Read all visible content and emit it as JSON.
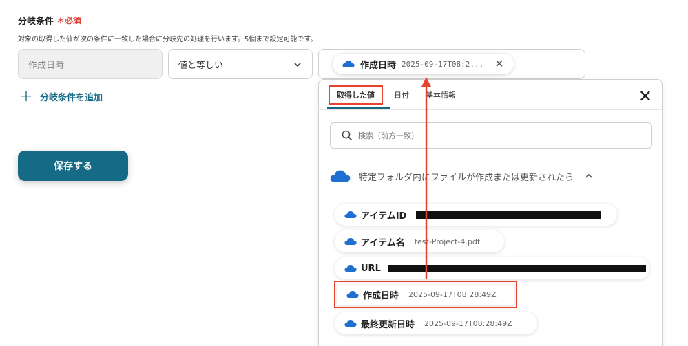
{
  "section": {
    "title": "分岐条件",
    "required_mark": "＊必須",
    "description": "対象の取得した値が次の条件に一致した場合に分岐先の処理を行います。5個まで設定可能です。"
  },
  "condition": {
    "field": "作成日時",
    "operator": "値と等しい",
    "value_chip": {
      "label": "作成日時",
      "value": "2025-09-17T08:2..."
    }
  },
  "add_condition_label": "分岐条件を追加",
  "save_label": "保存する",
  "panel": {
    "tabs": [
      {
        "label": "取得した値",
        "active": true
      },
      {
        "label": "日付",
        "active": false
      },
      {
        "label": "基本情報",
        "active": false
      }
    ],
    "search_placeholder": "検索（前方一致）",
    "group_title": "特定フォルダ内にファイルが作成または更新されたら",
    "items": [
      {
        "label": "アイテムID",
        "value": "",
        "redacted": true
      },
      {
        "label": "アイテム名",
        "value": "test-Project-4.pdf",
        "redacted": false
      },
      {
        "label": "URL",
        "value": "",
        "redacted": true
      },
      {
        "label": "作成日時",
        "value": "2025-09-17T08:28:49Z",
        "redacted": false,
        "highlighted": true
      },
      {
        "label": "最終更新日時",
        "value": "2025-09-17T08:28:49Z",
        "redacted": false
      }
    ]
  },
  "colors": {
    "accent": "#156b86",
    "highlight": "#e8432f",
    "cloud": "#1f6fd0"
  },
  "icons": [
    "onedrive-cloud-icon",
    "chevron-down-icon",
    "close-icon",
    "plus-icon",
    "search-icon",
    "chevron-up-icon"
  ]
}
